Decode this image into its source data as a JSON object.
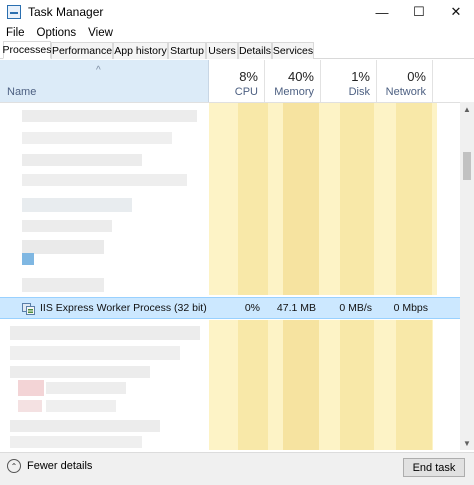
{
  "window": {
    "title": "Task Manager",
    "minimize_glyph": "—",
    "maximize_glyph": "☐",
    "close_glyph": "✕"
  },
  "menu": [
    "File",
    "Options",
    "View"
  ],
  "tabs": [
    "Processes",
    "Performance",
    "App history",
    "Startup",
    "Users",
    "Details",
    "Services"
  ],
  "active_tab": "Processes",
  "columns": {
    "name": {
      "label": "Name",
      "sort_glyph": "^"
    },
    "cpu": {
      "percent": "8%",
      "label": "CPU"
    },
    "memory": {
      "percent": "40%",
      "label": "Memory"
    },
    "disk": {
      "percent": "1%",
      "label": "Disk"
    },
    "network": {
      "percent": "0%",
      "label": "Network"
    }
  },
  "highlighted_process": {
    "name": "IIS Express Worker Process (32 bit)",
    "cpu": "0%",
    "memory": "47.1 MB",
    "disk": "0 MB/s",
    "network": "0 Mbps",
    "icon": "iis-process-icon"
  },
  "footer": {
    "fewer_details": "Fewer details",
    "end_task": "End task"
  },
  "colors": {
    "selection": "#cce8ff",
    "column_highlight": "#fff4c4",
    "sorted_header": "#dcebf8"
  }
}
